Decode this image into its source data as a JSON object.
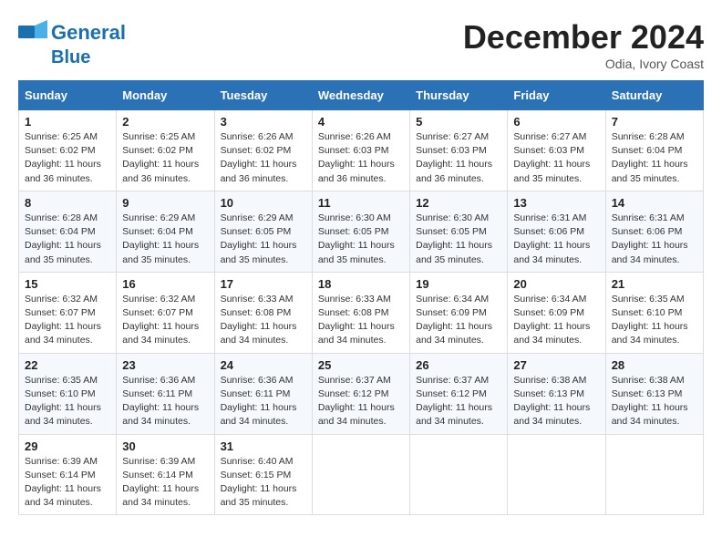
{
  "logo": {
    "line1": "General",
    "line2": "Blue"
  },
  "title": "December 2024",
  "location": "Odia, Ivory Coast",
  "days_of_week": [
    "Sunday",
    "Monday",
    "Tuesday",
    "Wednesday",
    "Thursday",
    "Friday",
    "Saturday"
  ],
  "weeks": [
    [
      {
        "day": "1",
        "sunrise": "6:25 AM",
        "sunset": "6:02 PM",
        "daylight": "11 hours and 36 minutes."
      },
      {
        "day": "2",
        "sunrise": "6:25 AM",
        "sunset": "6:02 PM",
        "daylight": "11 hours and 36 minutes."
      },
      {
        "day": "3",
        "sunrise": "6:26 AM",
        "sunset": "6:02 PM",
        "daylight": "11 hours and 36 minutes."
      },
      {
        "day": "4",
        "sunrise": "6:26 AM",
        "sunset": "6:03 PM",
        "daylight": "11 hours and 36 minutes."
      },
      {
        "day": "5",
        "sunrise": "6:27 AM",
        "sunset": "6:03 PM",
        "daylight": "11 hours and 36 minutes."
      },
      {
        "day": "6",
        "sunrise": "6:27 AM",
        "sunset": "6:03 PM",
        "daylight": "11 hours and 35 minutes."
      },
      {
        "day": "7",
        "sunrise": "6:28 AM",
        "sunset": "6:04 PM",
        "daylight": "11 hours and 35 minutes."
      }
    ],
    [
      {
        "day": "8",
        "sunrise": "6:28 AM",
        "sunset": "6:04 PM",
        "daylight": "11 hours and 35 minutes."
      },
      {
        "day": "9",
        "sunrise": "6:29 AM",
        "sunset": "6:04 PM",
        "daylight": "11 hours and 35 minutes."
      },
      {
        "day": "10",
        "sunrise": "6:29 AM",
        "sunset": "6:05 PM",
        "daylight": "11 hours and 35 minutes."
      },
      {
        "day": "11",
        "sunrise": "6:30 AM",
        "sunset": "6:05 PM",
        "daylight": "11 hours and 35 minutes."
      },
      {
        "day": "12",
        "sunrise": "6:30 AM",
        "sunset": "6:05 PM",
        "daylight": "11 hours and 35 minutes."
      },
      {
        "day": "13",
        "sunrise": "6:31 AM",
        "sunset": "6:06 PM",
        "daylight": "11 hours and 34 minutes."
      },
      {
        "day": "14",
        "sunrise": "6:31 AM",
        "sunset": "6:06 PM",
        "daylight": "11 hours and 34 minutes."
      }
    ],
    [
      {
        "day": "15",
        "sunrise": "6:32 AM",
        "sunset": "6:07 PM",
        "daylight": "11 hours and 34 minutes."
      },
      {
        "day": "16",
        "sunrise": "6:32 AM",
        "sunset": "6:07 PM",
        "daylight": "11 hours and 34 minutes."
      },
      {
        "day": "17",
        "sunrise": "6:33 AM",
        "sunset": "6:08 PM",
        "daylight": "11 hours and 34 minutes."
      },
      {
        "day": "18",
        "sunrise": "6:33 AM",
        "sunset": "6:08 PM",
        "daylight": "11 hours and 34 minutes."
      },
      {
        "day": "19",
        "sunrise": "6:34 AM",
        "sunset": "6:09 PM",
        "daylight": "11 hours and 34 minutes."
      },
      {
        "day": "20",
        "sunrise": "6:34 AM",
        "sunset": "6:09 PM",
        "daylight": "11 hours and 34 minutes."
      },
      {
        "day": "21",
        "sunrise": "6:35 AM",
        "sunset": "6:10 PM",
        "daylight": "11 hours and 34 minutes."
      }
    ],
    [
      {
        "day": "22",
        "sunrise": "6:35 AM",
        "sunset": "6:10 PM",
        "daylight": "11 hours and 34 minutes."
      },
      {
        "day": "23",
        "sunrise": "6:36 AM",
        "sunset": "6:11 PM",
        "daylight": "11 hours and 34 minutes."
      },
      {
        "day": "24",
        "sunrise": "6:36 AM",
        "sunset": "6:11 PM",
        "daylight": "11 hours and 34 minutes."
      },
      {
        "day": "25",
        "sunrise": "6:37 AM",
        "sunset": "6:12 PM",
        "daylight": "11 hours and 34 minutes."
      },
      {
        "day": "26",
        "sunrise": "6:37 AM",
        "sunset": "6:12 PM",
        "daylight": "11 hours and 34 minutes."
      },
      {
        "day": "27",
        "sunrise": "6:38 AM",
        "sunset": "6:13 PM",
        "daylight": "11 hours and 34 minutes."
      },
      {
        "day": "28",
        "sunrise": "6:38 AM",
        "sunset": "6:13 PM",
        "daylight": "11 hours and 34 minutes."
      }
    ],
    [
      {
        "day": "29",
        "sunrise": "6:39 AM",
        "sunset": "6:14 PM",
        "daylight": "11 hours and 34 minutes."
      },
      {
        "day": "30",
        "sunrise": "6:39 AM",
        "sunset": "6:14 PM",
        "daylight": "11 hours and 34 minutes."
      },
      {
        "day": "31",
        "sunrise": "6:40 AM",
        "sunset": "6:15 PM",
        "daylight": "11 hours and 35 minutes."
      },
      null,
      null,
      null,
      null
    ]
  ]
}
